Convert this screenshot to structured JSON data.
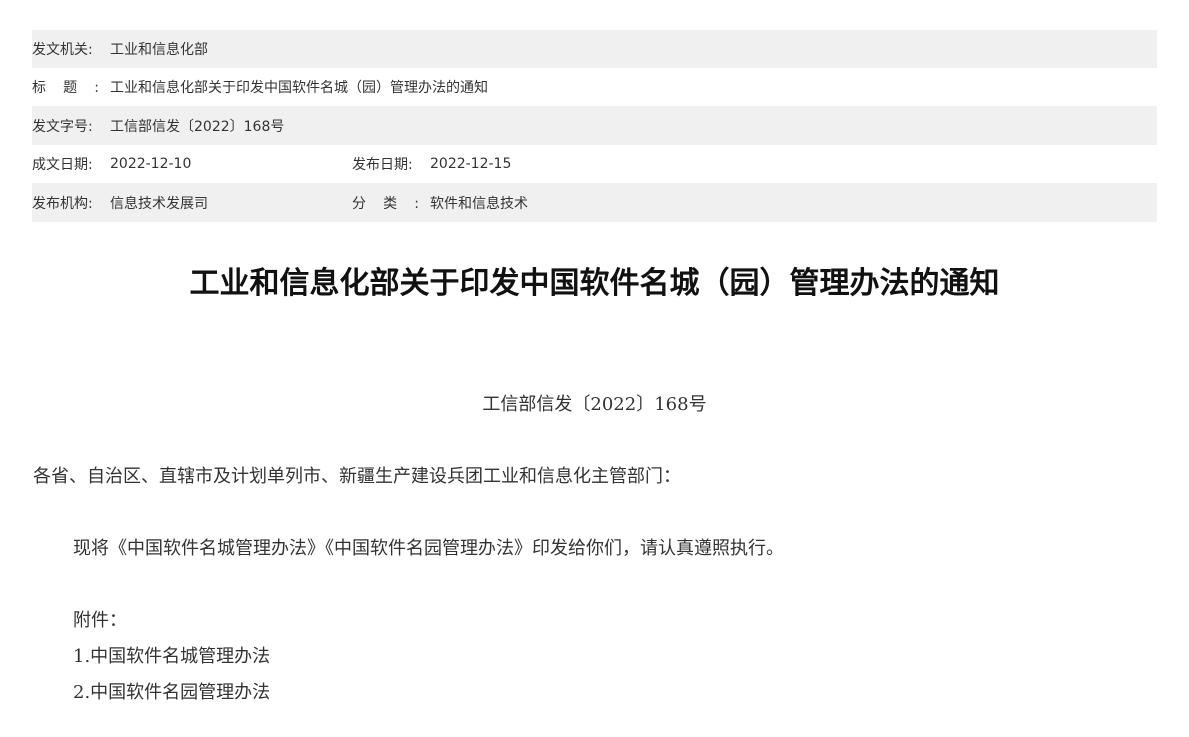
{
  "meta": {
    "issuer_label": "发文机关:",
    "issuer_value": "工业和信息化部",
    "title_label": "标题:",
    "title_value": "工业和信息化部关于印发中国软件名城（园）管理办法的通知",
    "docno_label": "发文字号:",
    "docno_value": "工信部信发〔2022〕168号",
    "written_label": "成文日期:",
    "written_value": "2022-12-10",
    "published_label": "发布日期:",
    "published_value": "2022-12-15",
    "org_label": "发布机构:",
    "org_value": "信息技术发展司",
    "category_label": "分类:",
    "category_value": "软件和信息技术"
  },
  "document": {
    "title": "工业和信息化部关于印发中国软件名城（园）管理办法的通知",
    "doc_number": "工信部信发〔2022〕168号",
    "addressee": "各省、自治区、直辖市及计划单列市、新疆生产建设兵团工业和信息化主管部门：",
    "paragraph": "现将《中国软件名城管理办法》《中国软件名园管理办法》印发给你们，请认真遵照执行。",
    "attachments_label": "附件：",
    "attachments": [
      "1.中国软件名城管理办法",
      "2.中国软件名园管理办法"
    ]
  }
}
